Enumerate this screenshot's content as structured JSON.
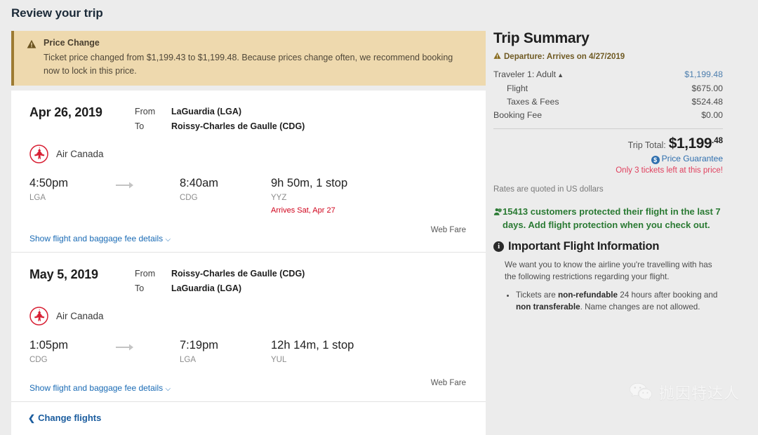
{
  "page_title": "Review your trip",
  "alert": {
    "icon": "warning-triangle-icon",
    "title": "Price Change",
    "body": "Ticket price changed from $1,199.43 to $1,199.48. Because prices change often, we recommend booking now to lock in this price."
  },
  "segments": [
    {
      "date": "Apr 26, 2019",
      "from_label": "From",
      "to_label": "To",
      "from_value": "LaGuardia (LGA)",
      "to_value": "Roissy-Charles de Gaulle (CDG)",
      "airline": "Air Canada",
      "fare_type": "Web Fare",
      "depart_time": "4:50pm",
      "depart_code": "LGA",
      "arrive_time": "8:40am",
      "arrive_code": "CDG",
      "duration": "9h 50m, 1 stop",
      "stop_code": "YYZ",
      "arrives_note": "Arrives Sat, Apr 27",
      "details_link": "Show flight and baggage fee details"
    },
    {
      "date": "May 5, 2019",
      "from_label": "From",
      "to_label": "To",
      "from_value": "Roissy-Charles de Gaulle (CDG)",
      "to_value": "LaGuardia (LGA)",
      "airline": "Air Canada",
      "fare_type": "Web Fare",
      "depart_time": "1:05pm",
      "depart_code": "CDG",
      "arrive_time": "7:19pm",
      "arrive_code": "LGA",
      "duration": "12h 14m, 1 stop",
      "stop_code": "YUL",
      "arrives_note": "",
      "details_link": "Show flight and baggage fee details"
    }
  ],
  "change_flights_label": "Change flights",
  "summary": {
    "title": "Trip Summary",
    "departure_note": "Departure: Arrives on 4/27/2019",
    "rows": [
      {
        "label": "Traveler 1: Adult",
        "value": "$1,199.48",
        "style": "link",
        "indent": false
      },
      {
        "label": "Flight",
        "value": "$675.00",
        "style": "plain",
        "indent": true
      },
      {
        "label": "Taxes & Fees",
        "value": "$524.48",
        "style": "plain",
        "indent": true
      },
      {
        "label": "Booking Fee",
        "value": "$0.00",
        "style": "plain",
        "indent": false
      }
    ],
    "total_label": "Trip Total:",
    "total_amount": "$1,199",
    "total_cents": ".48",
    "price_guarantee": "Price Guarantee",
    "tickets_left": "Only 3 tickets left at this price!",
    "rates_note": "Rates are quoted in US dollars",
    "protection_text": "15413 customers protected their flight in the last 7 days. Add flight protection when you check out.",
    "important_title": "Important Flight Information",
    "important_body": "We want you to know the airline you're travelling with has the following restrictions regarding your flight.",
    "important_bullet_pre": "Tickets are ",
    "important_bullet_b1": "non-refundable",
    "important_bullet_mid": " 24 hours after booking and ",
    "important_bullet_b2": "non transferable",
    "important_bullet_post": ". Name changes are not allowed."
  },
  "watermark": {
    "icon": "wechat-icon",
    "text": "抛因特达人"
  },
  "colors": {
    "page_bg": "#ececec",
    "alert_bg": "#eed9ae",
    "alert_border": "#9d7b32",
    "link_blue": "#1a6bb5",
    "accent_red": "#d0021b",
    "green": "#2a7a33",
    "airline_red": "#d81f33"
  }
}
